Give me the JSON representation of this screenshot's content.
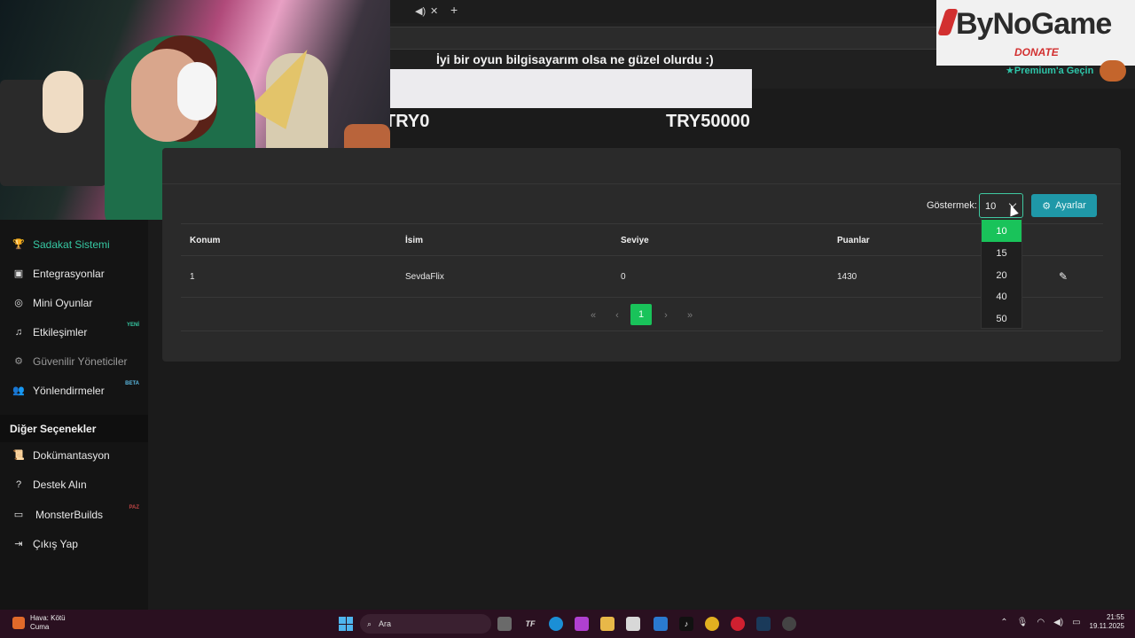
{
  "browser": {
    "mute_icon": "speaker-icon",
    "close_tab_icon": "close-icon",
    "new_tab_icon": "plus-icon"
  },
  "goal": {
    "title": "İyi bir oyun bilgisayarım olsa ne güzel olurdu :)",
    "min_label": "TRY0",
    "max_label": "TRY50000",
    "progress_fraction": 0
  },
  "overlay": {
    "brand": "ByNoGame",
    "donate": "DONATE",
    "premium": "Premium'a Geçin"
  },
  "sidebar": {
    "items": [
      {
        "label": "Sadakat Sistemi",
        "icon": "trophy-icon",
        "state": "active"
      },
      {
        "label": "Entegrasyonlar",
        "icon": "plug-icon",
        "state": "normal"
      },
      {
        "label": "Mini Oyunlar",
        "icon": "gamepad-icon",
        "state": "normal"
      },
      {
        "label": "Etkileşimler",
        "icon": "music-icon",
        "state": "normal",
        "badge": "YENİ"
      },
      {
        "label": "Güvenilir Yöneticiler",
        "icon": "users-cog-icon",
        "state": "disabled"
      },
      {
        "label": "Yönlendirmeler",
        "icon": "user-group-icon",
        "state": "normal",
        "badge": "BETA"
      }
    ],
    "section_title": "Diğer Seçenekler",
    "other": [
      {
        "label": "Dokümantasyon",
        "icon": "scroll-icon"
      },
      {
        "label": "Destek Alın",
        "icon": "question-icon"
      },
      {
        "label": "MonsterBuilds",
        "icon": "laptop-icon",
        "badge": "PAZ"
      },
      {
        "label": "Çıkış Yap",
        "icon": "logout-icon"
      }
    ]
  },
  "table": {
    "show_label": "Göstermek:",
    "page_size": "10",
    "settings_label": "Ayarlar",
    "headers": [
      "Konum",
      "İsim",
      "Seviye",
      "Puanlar"
    ],
    "rows": [
      [
        "1",
        "SevdaFlix",
        "0",
        "1430"
      ]
    ],
    "pager": {
      "first": "«",
      "prev": "‹",
      "current": "1",
      "next": "›",
      "last": "»"
    },
    "page_size_options": [
      "10",
      "15",
      "20",
      "40",
      "50"
    ]
  },
  "taskbar": {
    "weather_title": "Hava: Kötü",
    "weather_sub": "Cuma",
    "search_placeholder": "Ara",
    "time": "21:55",
    "date": "19.11.2025"
  },
  "colors": {
    "accent": "#36c8a3",
    "select_green": "#19c35a",
    "settings_blue": "#1f98a8"
  }
}
